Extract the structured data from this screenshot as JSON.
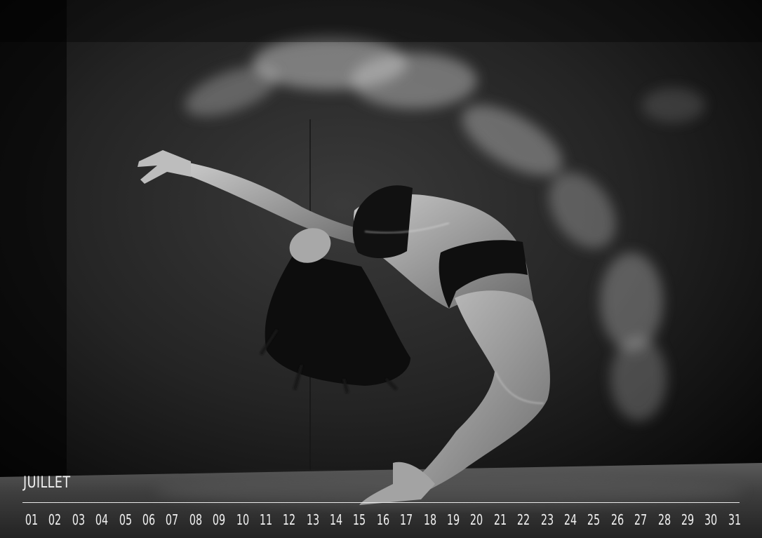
{
  "calendar": {
    "month": "JUILLET",
    "days": [
      "01",
      "02",
      "03",
      "04",
      "05",
      "06",
      "07",
      "08",
      "09",
      "10",
      "11",
      "12",
      "13",
      "14",
      "15",
      "16",
      "17",
      "18",
      "19",
      "20",
      "21",
      "22",
      "23",
      "24",
      "25",
      "26",
      "27",
      "28",
      "29",
      "30",
      "31"
    ]
  },
  "photo": {
    "subject": "dancer-backbend-with-powder-cloud",
    "style": "black-and-white"
  }
}
